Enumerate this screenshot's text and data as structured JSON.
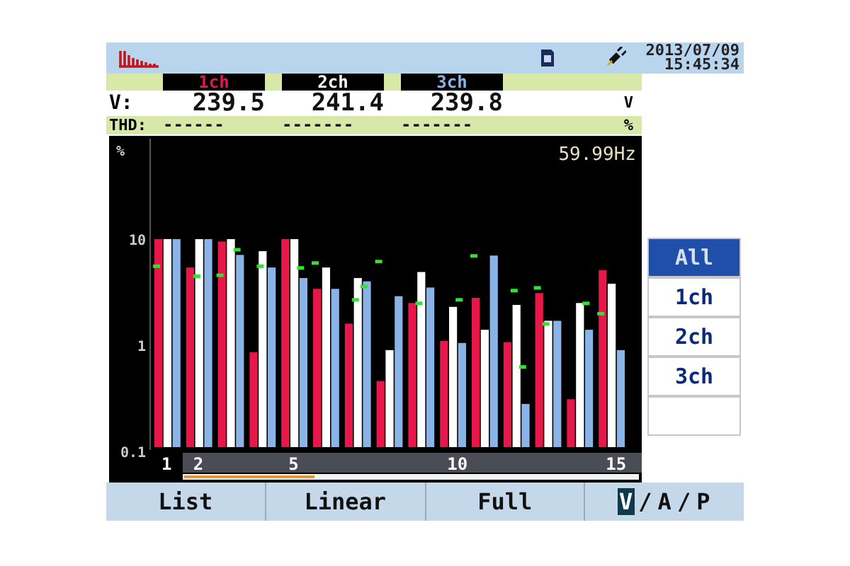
{
  "status_bar": {
    "date": "2013/07/09",
    "time": "15:45:34"
  },
  "channels": [
    {
      "label": "1ch",
      "voltage": "239.5",
      "thd": "------"
    },
    {
      "label": "2ch",
      "voltage": "241.4",
      "thd": "-------"
    },
    {
      "label": "3ch",
      "voltage": "239.8",
      "thd": "-------"
    }
  ],
  "voltage_row": {
    "label": "V:",
    "unit": "V"
  },
  "thd_row": {
    "label": "THD:",
    "unit": "%"
  },
  "frequency": "59.99Hz",
  "chart": {
    "ylabel": "%",
    "y_labels": [
      "10",
      "1",
      "0.1"
    ],
    "x_labels": [
      "1",
      "2",
      "5",
      "10",
      "15"
    ]
  },
  "channel_buttons": [
    {
      "label": "All",
      "selected": true
    },
    {
      "label": "1ch",
      "selected": false
    },
    {
      "label": "2ch",
      "selected": false
    },
    {
      "label": "3ch",
      "selected": false
    }
  ],
  "function_keys": [
    "List",
    "Linear",
    "Full"
  ],
  "mode": {
    "separator": "/",
    "items": [
      {
        "label": "V",
        "selected": true
      },
      {
        "label": "A",
        "selected": false
      },
      {
        "label": "P",
        "selected": false
      }
    ]
  }
}
